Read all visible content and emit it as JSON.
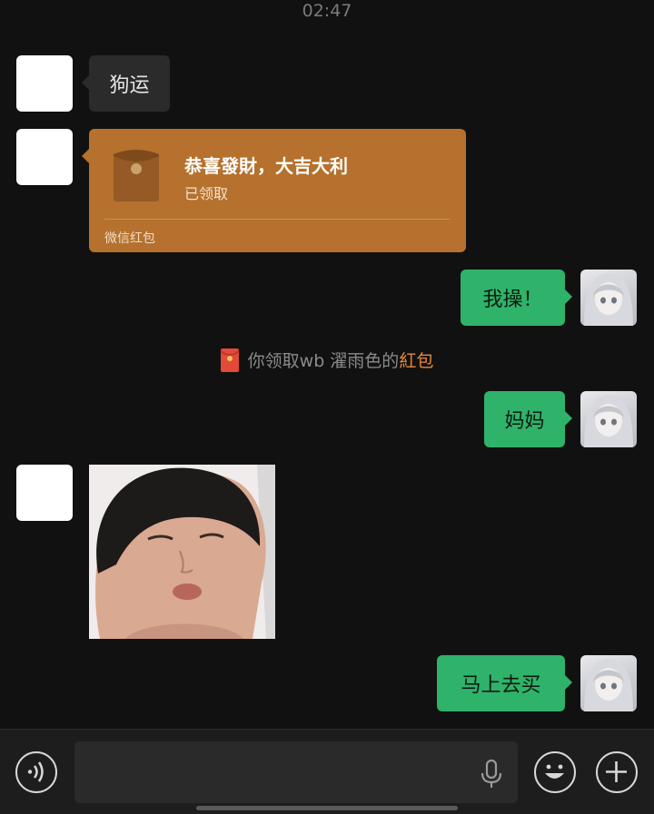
{
  "status": {
    "time": "02:47"
  },
  "messages": {
    "m1": {
      "text": "狗运"
    },
    "red_packet": {
      "title": "恭喜發財，大吉大利",
      "status": "已领取",
      "footer": "微信红包"
    },
    "m2": {
      "text": "我操！"
    },
    "system": {
      "prefix": "你领取wb 濯雨色的",
      "highlight": "紅包"
    },
    "m3": {
      "text": "妈妈"
    },
    "m4": {
      "text": "马上去买"
    }
  },
  "colors": {
    "background": "#111111",
    "incoming_bubble": "#2b2b2b",
    "outgoing_bubble": "#2fb36a",
    "red_packet": "#b5712d",
    "highlight": "#e9893c"
  },
  "icons": {
    "voice": "voice-input-icon",
    "mic": "microphone-icon",
    "emoji": "emoji-icon",
    "more": "plus-icon"
  }
}
